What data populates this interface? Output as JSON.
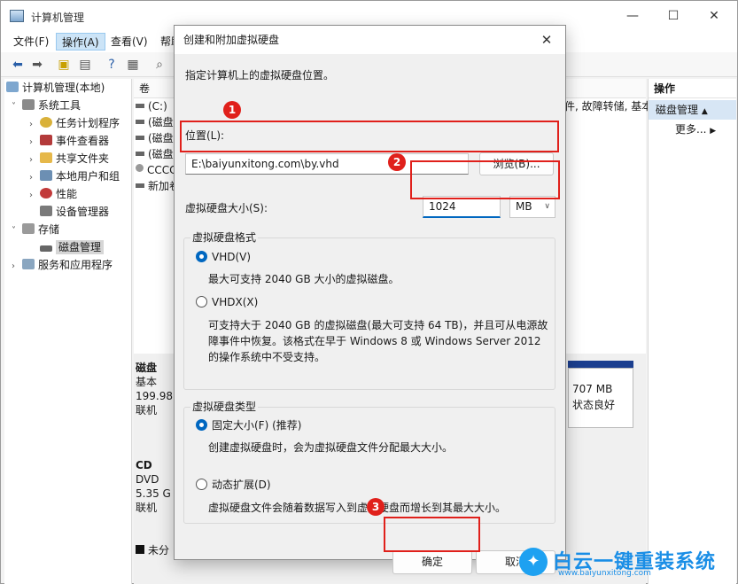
{
  "window": {
    "title": "计算机管理",
    "controls": {
      "minimize": "—",
      "maximize": "☐",
      "close": "✕"
    }
  },
  "menu": [
    "文件(F)",
    "操作(A)",
    "查看(V)",
    "帮助"
  ],
  "tree": {
    "root": "计算机管理(本地)",
    "system_tools": "系统工具",
    "items": [
      "任务计划程序",
      "事件查看器",
      "共享文件夹",
      "本地用户和组",
      "性能",
      "设备管理器"
    ],
    "storage": "存储",
    "disk_mgmt": "磁盘管理",
    "services": "服务和应用程序"
  },
  "list": {
    "col_header": "卷",
    "rows": [
      "(C:)",
      "(磁盘",
      "(磁盘",
      "(磁盘",
      "CCCC",
      "新加卷"
    ],
    "right_fragment": "件, 故障转储, 基本"
  },
  "disks": {
    "disk0": {
      "name": "磁盘",
      "type": "基本",
      "size": "199.98",
      "status": "联机"
    },
    "cd": {
      "name": "CD",
      "type": "DVD",
      "size": "5.35 G",
      "status": "联机"
    },
    "unallocated": "未分",
    "partition": {
      "size": "707 MB",
      "status": "状态良好"
    }
  },
  "actions": {
    "header": "操作",
    "selected": "磁盘管理",
    "more": "更多..."
  },
  "dialog": {
    "title": "创建和附加虚拟硬盘",
    "instruction": "指定计算机上的虚拟硬盘位置。",
    "location_label": "位置(L):",
    "location_value": "E:\\baiyunxitong.com\\by.vhd",
    "browse": "浏览(B)...",
    "size_label": "虚拟硬盘大小(S):",
    "size_value": "1024",
    "size_unit": "MB",
    "format_group": "虚拟硬盘格式",
    "vhd_label": "VHD(V)",
    "vhd_desc": "最大可支持 2040 GB 大小的虚拟磁盘。",
    "vhdx_label": "VHDX(X)",
    "vhdx_desc1": "可支持大于 2040 GB 的虚拟磁盘(最大可支持 64 TB)，并且可从电源故",
    "vhdx_desc2": "障事件中恢复。该格式在早于 Windows 8 或 Windows Server 2012",
    "vhdx_desc3": "的操作系统中不受支持。",
    "type_group": "虚拟硬盘类型",
    "fixed_label": "固定大小(F) (推荐)",
    "fixed_desc": "创建虚拟硬盘时，会为虚拟硬盘文件分配最大大小。",
    "dynamic_label": "动态扩展(D)",
    "dynamic_desc": "虚拟硬盘文件会随着数据写入到虚拟硬盘而增长到其最大大小。",
    "ok": "确定",
    "cancel": "取消"
  },
  "annotations": {
    "step1": "1",
    "step2": "2",
    "step3": "3"
  },
  "watermark": {
    "name": "白云一键重装系统",
    "url": "www.baiyunxitong.com"
  }
}
